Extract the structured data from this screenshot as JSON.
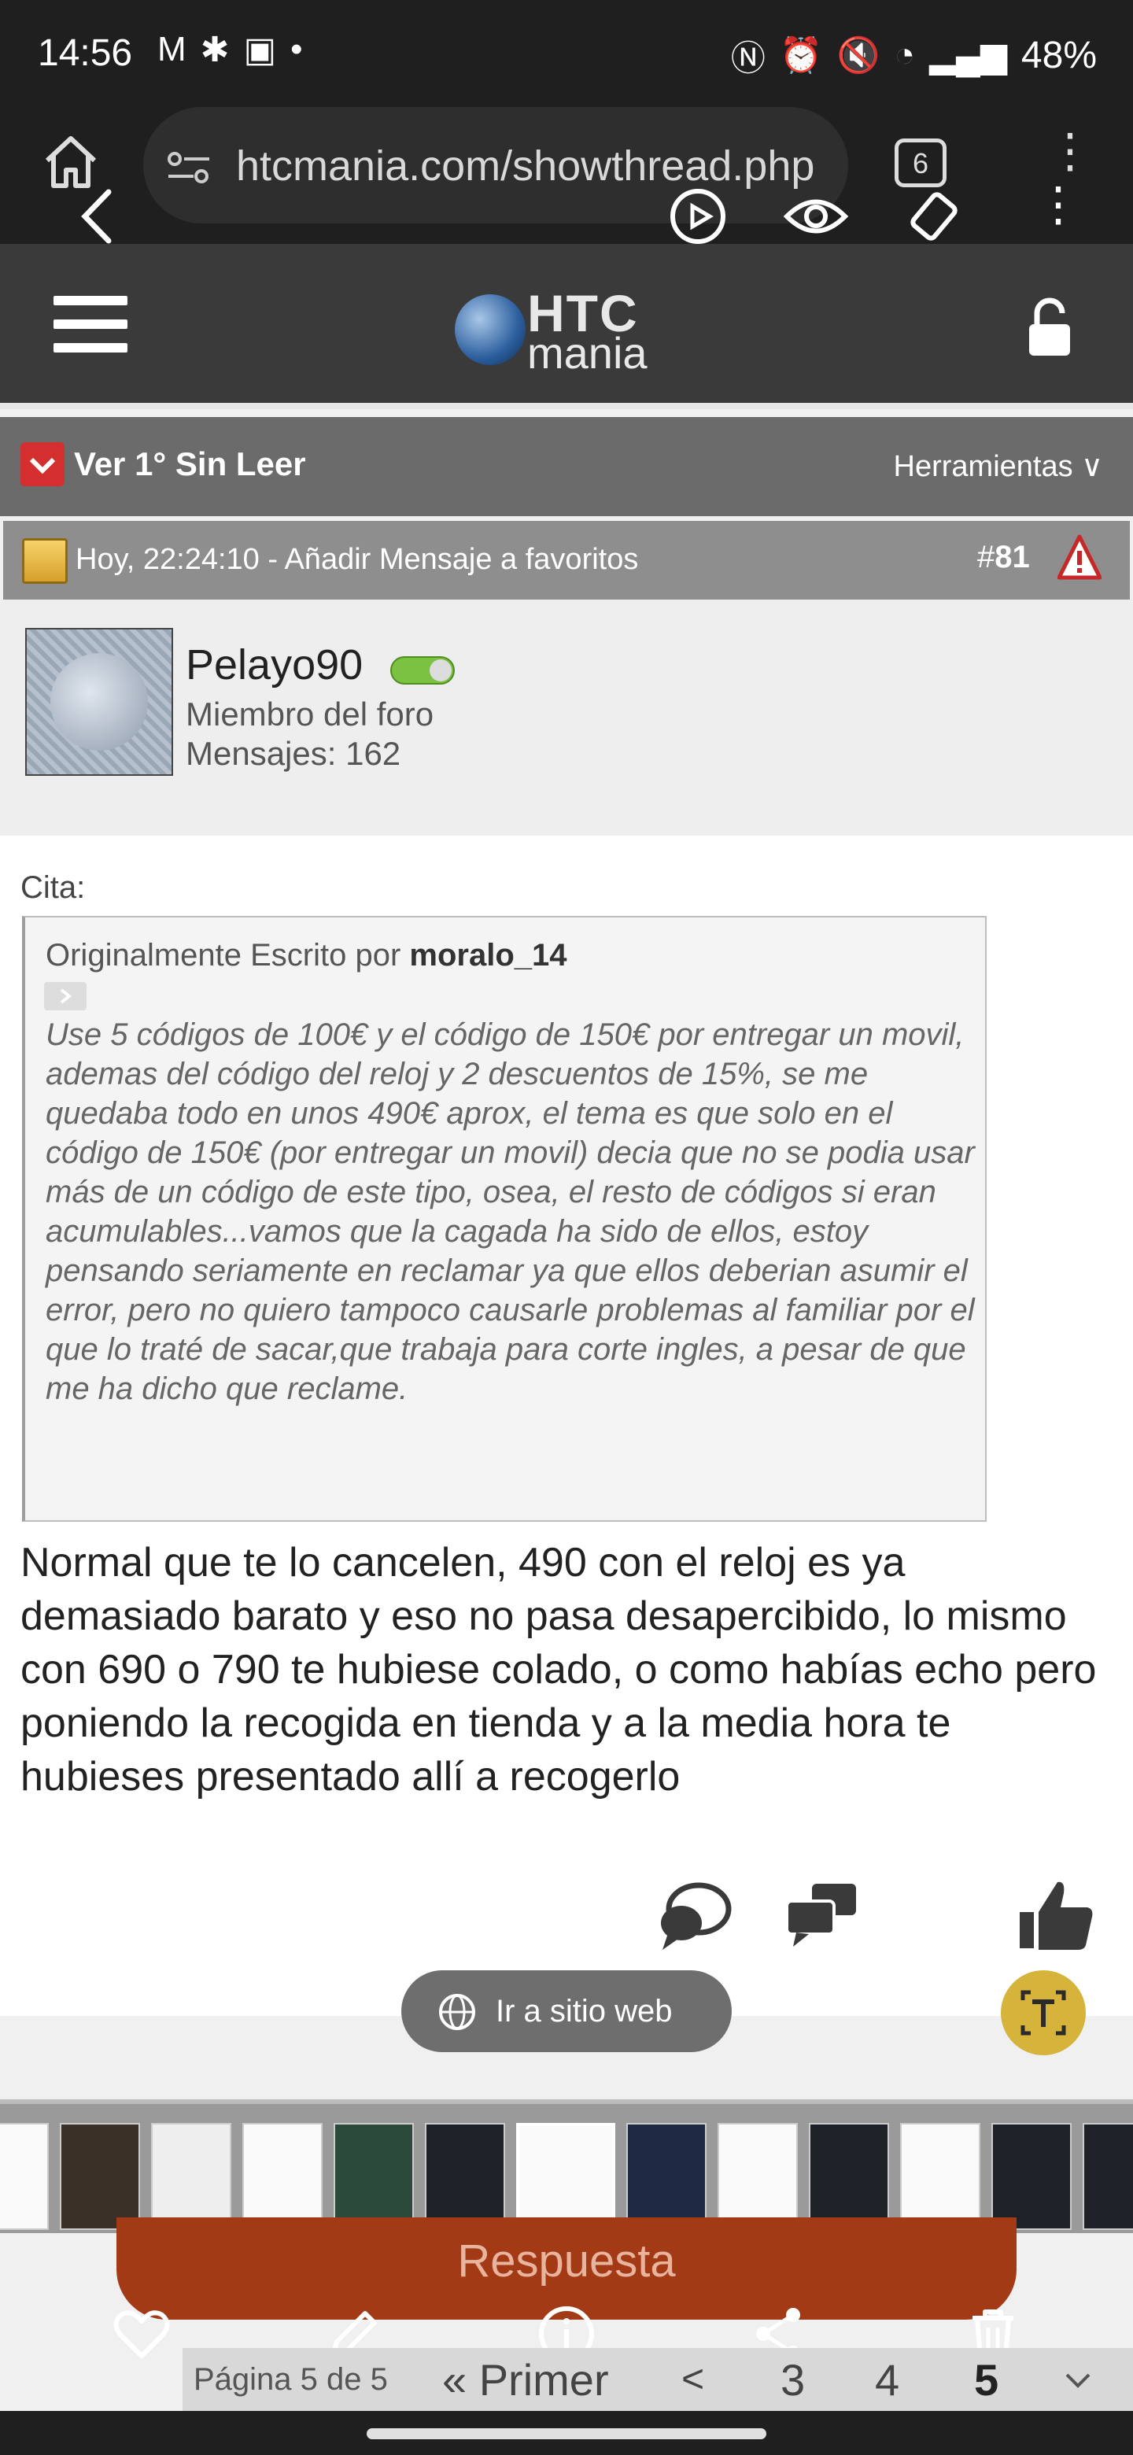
{
  "status_bar": {
    "time": "14:56",
    "left_icons": [
      "gmail-icon",
      "slack-icon",
      "image-icon",
      "dot-icon"
    ],
    "right_icons": [
      "nfc-icon",
      "alarm-icon",
      "mute-icon",
      "wifi-icon",
      "signal-icon"
    ],
    "battery": "48%"
  },
  "browser": {
    "url": "htcmania.com/showthread.php",
    "tab_count": "6"
  },
  "site": {
    "logo_top": "HTC",
    "logo_bottom": "mania"
  },
  "thread_bar": {
    "ver_label": "Ver 1° Sin Leer",
    "tools_label": "Herramientas"
  },
  "post": {
    "date_text": "Hoy, 22:24:10 - Añadir Mensaje a favoritos",
    "number_prefix": "#",
    "number": "81",
    "user": {
      "name": "Pelayo90",
      "role": "Miembro del foro",
      "posts": "Mensajes: 162"
    },
    "quote_label": "Cita:",
    "quote_by_prefix": "Originalmente Escrito por ",
    "quote_author": "moralo_14",
    "quote_text": "Use 5 códigos de 100€ y el código de 150€ por entregar un movil, ademas del código del reloj y 2 descuentos de 15%, se me quedaba todo en unos 490€ aprox, el tema es que solo en el código de 150€ (por entregar un movil) decia que no se podia usar más de un código de este tipo, osea, el resto de códigos si eran acumulables...vamos que la cagada ha sido de ellos, estoy pensando seriamente en reclamar ya que ellos deberian asumir el error, pero no quiero tampoco causarle problemas al familiar por el que lo traté de sacar,que trabaja para corte ingles, a pesar de que me ha dicho que reclame.",
    "body_text": "Normal que te lo cancelen, 490 con el reloj es ya demasiado barato y eso no pasa desapercibido, lo mismo con 690 o 790 te hubiese colado, o como habías echo pero poniendo la recogida en tienda y a la media hora te hubieses presentado allí a recogerlo"
  },
  "overlay": {
    "site_button": "Ir a sitio web",
    "reply_button": "Respuesta"
  },
  "pagination": {
    "info": "Página 5 de 5",
    "first": "« Primer",
    "prev": "<",
    "pages": [
      "3",
      "4",
      "5"
    ],
    "current": "5"
  },
  "colors": {
    "reply": "#a33a16",
    "thread_bar": "#6b6b6b",
    "post_header": "#8e8e8e",
    "accent_red": "#d32f2f"
  }
}
